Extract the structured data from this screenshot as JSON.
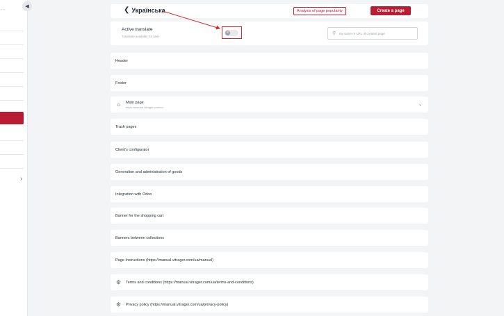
{
  "sidebar": {
    "collapse_icon": "chevron-left-icon",
    "expand_icon": "chevron-right-icon",
    "dots": "..."
  },
  "header": {
    "title": "Українська",
    "analysis_button": "Analysis of page popularity",
    "create_button": "Create a page"
  },
  "translate": {
    "title": "Active translate",
    "subtitle": "Translate available for user",
    "enabled": false,
    "search_placeholder": "By name or URL of created page"
  },
  "rows": [
    {
      "label": "Header"
    },
    {
      "label": "Footer"
    },
    {
      "label": "Main page",
      "sub": "https://manual.vitrager.com/ua",
      "icon": "home-icon",
      "expandable": true
    },
    {
      "label": "Trash pages"
    },
    {
      "label": "Client's configurator"
    },
    {
      "label": "Generation and administration of goods"
    },
    {
      "label": "Integration with Odoo"
    },
    {
      "label": "Banner for the shopping cart"
    },
    {
      "label": "Banners between collections"
    },
    {
      "label": "Page Instructions (https://manual.vitrager.com/ua/manual)"
    },
    {
      "label": "Terms and conditions (https://manual.vitrager.com/ua/terms-and-conditions)",
      "icon": "gear-icon"
    },
    {
      "label": "Privacy policy (https://manual.vitrager.com/ua/privacy-policy)",
      "icon": "gear-icon"
    }
  ],
  "colors": {
    "accent": "#b91c33",
    "highlight": "#dc2626",
    "background": "#f3f4f6"
  }
}
